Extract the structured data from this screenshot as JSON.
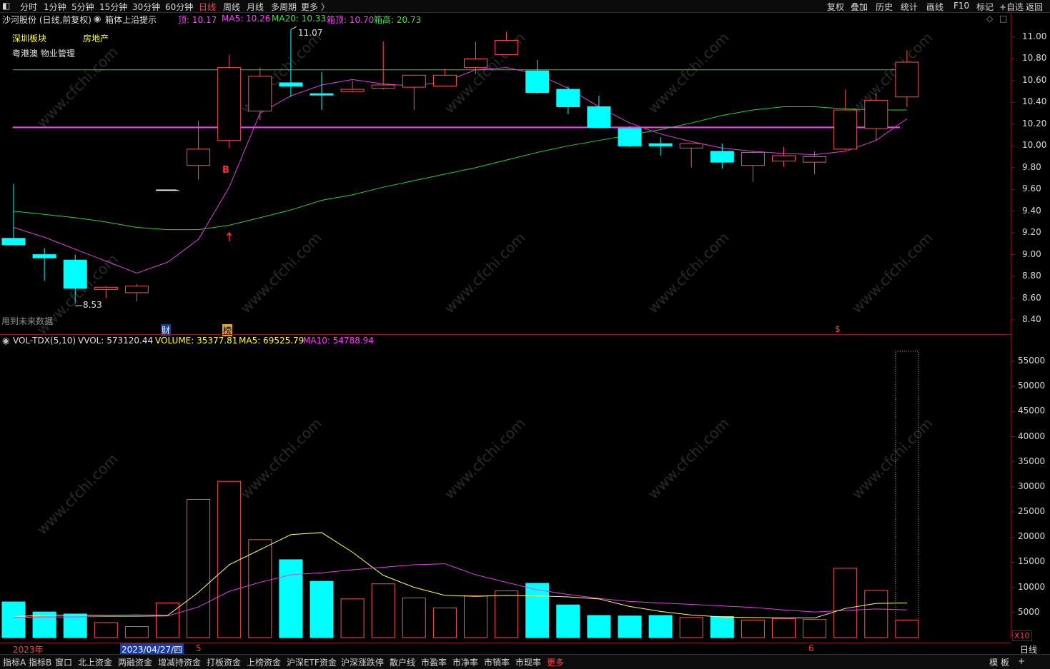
{
  "toolbar": {
    "left_items": [
      "分时",
      "1分钟",
      "5分钟",
      "15分钟",
      "30分钟",
      "60分钟",
      "日线",
      "周线",
      "月线",
      "多周期",
      "更多 〉"
    ],
    "active": "日线",
    "right_items": [
      "复权",
      "叠加",
      "历史",
      "统计",
      "画线",
      "F10",
      "标记",
      "+自选",
      "返回"
    ]
  },
  "info": {
    "title": "沙河股份 (日线,前复权)",
    "indicator_name": "箱体上沿提示",
    "top": "顶: 10.17",
    "ma5": "MA5: 10.26",
    "ma20": "MA20: 10.33",
    "box_top": "箱顶: 10.70",
    "box_high": "箱高: 20.73"
  },
  "tags": {
    "board": "深圳板块",
    "industry": "房地产",
    "concept": "粤港澳 物业管理",
    "future_data": "用到未来数据",
    "marker_cai": "财",
    "marker_bang": "榜",
    "marker_dollar": "$",
    "high_label": "11.07",
    "low_label": "8.53",
    "buy_label": "B"
  },
  "volume_info": {
    "name": "VOL-TDX(5,10)",
    "vvol": "VVOL: 573120.44",
    "volume": "VOLUME: 35377.81",
    "ma5": "MA5: 69525.79",
    "ma10": "MA10: 54788.94",
    "multiplier": "X10"
  },
  "price_ticks": [
    "11.00",
    "10.80",
    "10.60",
    "10.40",
    "10.20",
    "10.00",
    "9.80",
    "9.60",
    "9.40",
    "9.20",
    "9.00",
    "8.80",
    "8.60",
    "8.40"
  ],
  "volume_ticks": [
    "55000",
    "50000",
    "45000",
    "40000",
    "35000",
    "30000",
    "25000",
    "20000",
    "15000",
    "10000",
    "5000"
  ],
  "dates": {
    "year": "2023年",
    "cursor_date": "2023/04/27/四",
    "month5": "5",
    "month6": "6",
    "period": "日线"
  },
  "bottom_tabs": [
    "指标A",
    "指标B",
    "窗口",
    "北上资金",
    "两融资金",
    "增减持资金",
    "打板资金",
    "上榜资金",
    "沪深ETF资金",
    "沪深涨跌停",
    "散户线",
    "市盈率",
    "市净率",
    "市销率",
    "市现率",
    "更多"
  ],
  "bottom_right": [
    "模",
    "板",
    "+"
  ],
  "watermark": "www.cfchi.com",
  "colors": {
    "up": "#ff5050",
    "down": "#00ffff",
    "ma5": "#e040e0",
    "ma20": "#30d030",
    "box_line": "#ff40ff",
    "vol_ma5": "#ffff60",
    "vol_ma10": "#e040e0"
  },
  "chart_data": {
    "type": "candlestick",
    "price_ylim": [
      8.4,
      11.1
    ],
    "candles": [
      {
        "o": 9.15,
        "h": 9.65,
        "l": 9.1,
        "c": 9.09
      },
      {
        "o": 9.0,
        "h": 9.06,
        "l": 8.76,
        "c": 8.97
      },
      {
        "o": 8.95,
        "h": 9.0,
        "l": 8.55,
        "c": 8.69
      },
      {
        "o": 8.68,
        "h": 8.71,
        "l": 8.6,
        "c": 8.7
      },
      {
        "o": 8.65,
        "h": 8.73,
        "l": 8.57,
        "c": 8.71
      },
      {
        "o": 9.59,
        "h": 9.59,
        "l": 9.59,
        "c": 9.59
      },
      {
        "o": 9.82,
        "h": 10.23,
        "l": 9.69,
        "c": 9.97
      },
      {
        "o": 10.05,
        "h": 10.84,
        "l": 9.98,
        "c": 10.72
      },
      {
        "o": 10.32,
        "h": 10.72,
        "l": 10.24,
        "c": 10.64
      },
      {
        "o": 10.58,
        "h": 11.07,
        "l": 10.45,
        "c": 10.55
      },
      {
        "o": 10.48,
        "h": 10.68,
        "l": 10.33,
        "c": 10.47
      },
      {
        "o": 10.5,
        "h": 10.6,
        "l": 10.49,
        "c": 10.52
      },
      {
        "o": 10.53,
        "h": 10.96,
        "l": 10.52,
        "c": 10.56
      },
      {
        "o": 10.54,
        "h": 10.65,
        "l": 10.33,
        "c": 10.65
      },
      {
        "o": 10.55,
        "h": 10.71,
        "l": 10.55,
        "c": 10.65
      },
      {
        "o": 10.72,
        "h": 10.96,
        "l": 10.66,
        "c": 10.8
      },
      {
        "o": 10.84,
        "h": 11.05,
        "l": 10.84,
        "c": 10.97
      },
      {
        "o": 10.69,
        "h": 10.79,
        "l": 10.48,
        "c": 10.49
      },
      {
        "o": 10.52,
        "h": 10.55,
        "l": 10.29,
        "c": 10.36
      },
      {
        "o": 10.36,
        "h": 10.46,
        "l": 10.18,
        "c": 10.17
      },
      {
        "o": 10.16,
        "h": 10.18,
        "l": 9.99,
        "c": 10.0
      },
      {
        "o": 10.02,
        "h": 10.08,
        "l": 9.91,
        "c": 10.0
      },
      {
        "o": 9.98,
        "h": 10.02,
        "l": 9.8,
        "c": 10.02
      },
      {
        "o": 9.95,
        "h": 10.02,
        "l": 9.79,
        "c": 9.85
      },
      {
        "o": 9.82,
        "h": 9.95,
        "l": 9.67,
        "c": 9.94
      },
      {
        "o": 9.86,
        "h": 9.99,
        "l": 9.81,
        "c": 9.91
      },
      {
        "o": 9.85,
        "h": 9.95,
        "l": 9.74,
        "c": 9.9
      },
      {
        "o": 9.97,
        "h": 10.52,
        "l": 9.96,
        "c": 10.33
      },
      {
        "o": 10.16,
        "h": 10.48,
        "l": 10.05,
        "c": 10.42
      },
      {
        "o": 10.45,
        "h": 10.88,
        "l": 10.36,
        "c": 10.77
      }
    ],
    "ma5": [
      9.25,
      9.16,
      9.05,
      8.94,
      8.83,
      8.93,
      9.14,
      9.62,
      10.3,
      10.46,
      10.56,
      10.61,
      10.57,
      10.55,
      10.59,
      10.7,
      10.72,
      10.66,
      10.53,
      10.36,
      10.21,
      10.11,
      10.04,
      9.98,
      9.95,
      9.93,
      9.92,
      9.95,
      10.05,
      10.25
    ],
    "ma20": [
      9.4,
      9.37,
      9.34,
      9.3,
      9.25,
      9.23,
      9.23,
      9.27,
      9.34,
      9.41,
      9.5,
      9.55,
      9.62,
      9.68,
      9.74,
      9.8,
      9.87,
      9.94,
      10.0,
      10.05,
      10.1,
      10.15,
      10.21,
      10.28,
      10.33,
      10.36,
      10.36,
      10.34,
      10.33,
      10.33
    ],
    "box_top_line": 10.7,
    "box_line": 10.17,
    "volume_ylim": [
      0,
      58000
    ],
    "volumes": [
      7100,
      5100,
      4700,
      3000,
      2200,
      6900,
      27500,
      31100,
      19500,
      15500,
      11200,
      7700,
      10700,
      7900,
      5900,
      8300,
      9300,
      10800,
      6500,
      4400,
      4300,
      4400,
      4000,
      4200,
      3500,
      3800,
      3600,
      13800,
      9400,
      35378
    ],
    "volume_dir": [
      "d",
      "d",
      "d",
      "u",
      "u",
      "u",
      "u",
      "u",
      "u",
      "d",
      "d",
      "u",
      "u",
      "u",
      "u",
      "u",
      "u",
      "d",
      "d",
      "d",
      "d",
      "d",
      "u",
      "d",
      "u",
      "u",
      "u",
      "u",
      "u",
      "u"
    ],
    "vol_ma5": [
      4200,
      4400,
      4500,
      4400,
      4500,
      4400,
      9000,
      14500,
      17500,
      20500,
      20900,
      17000,
      12400,
      10000,
      8400,
      8200,
      8400,
      8300,
      8100,
      7700,
      6200,
      5200,
      4500,
      4100,
      4000,
      3900,
      3900,
      5800,
      6800,
      6900
    ],
    "vol_ma10": [
      4000,
      4100,
      4100,
      4200,
      4200,
      4300,
      6100,
      9200,
      11000,
      12500,
      12900,
      13500,
      14000,
      14500,
      14700,
      12500,
      11000,
      9500,
      8600,
      7800,
      7200,
      6900,
      6600,
      6300,
      6000,
      5500,
      5100,
      5400,
      5700,
      5500
    ]
  }
}
